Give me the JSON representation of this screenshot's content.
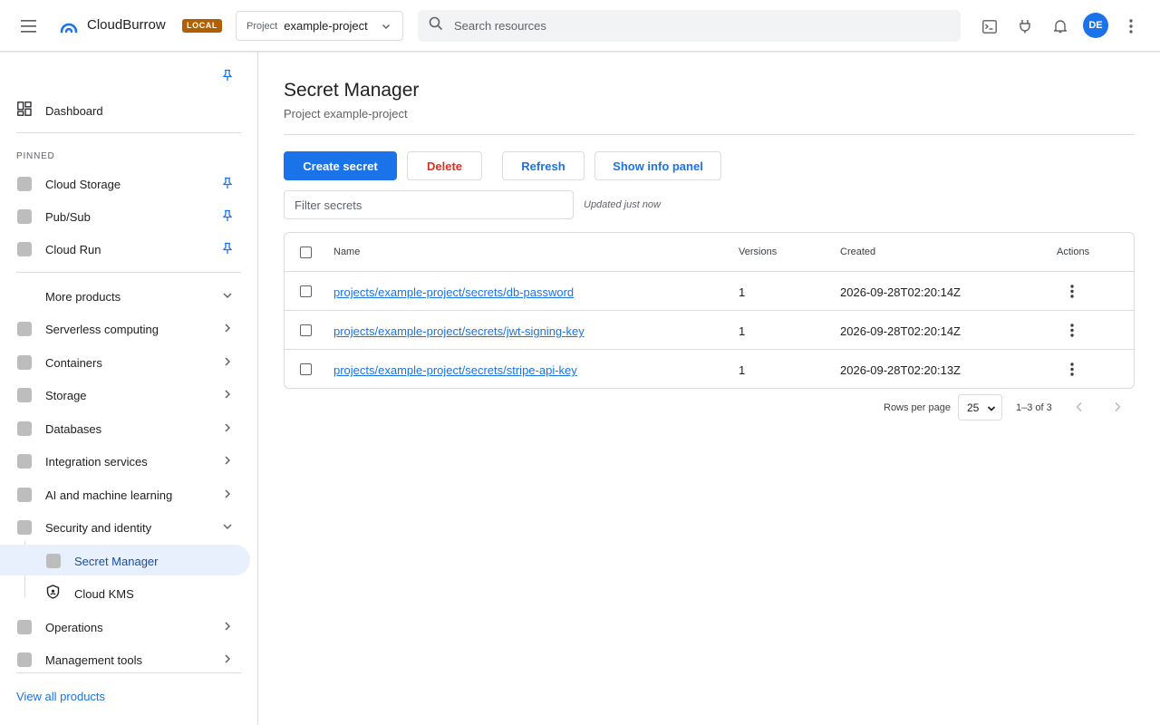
{
  "topbar": {
    "app_title": "CloudBurrow",
    "env_badge": "LOCAL",
    "project_label": "Project",
    "project_value": "example-project",
    "search_placeholder": "Search resources",
    "avatar_initials": "DE",
    "avatar_color": "#1a73e8"
  },
  "sidebar": {
    "dashboard": "Dashboard",
    "pinned_header": "PINNED",
    "pinned": [
      "Cloud Storage",
      "Pub/Sub",
      "Cloud Run"
    ],
    "more_products": "More products",
    "categories": [
      "Serverless computing",
      "Containers",
      "Storage",
      "Databases",
      "Integration services",
      "AI and machine learning",
      "Security and identity"
    ],
    "security_children": [
      "Secret Manager",
      "Cloud KMS"
    ],
    "active_item": "Secret Manager",
    "bottom_categories": [
      "Operations",
      "Management tools"
    ],
    "view_all": "View all products"
  },
  "main": {
    "title": "Secret Manager",
    "subtitle": "Project example-project",
    "buttons": {
      "create": "Create secret",
      "delete": "Delete",
      "refresh": "Refresh",
      "info_panel": "Show info panel"
    },
    "filter_placeholder": "Filter secrets",
    "updated_text": "Updated just now",
    "table": {
      "columns": [
        "Name",
        "Versions",
        "Created",
        "Actions"
      ],
      "rows": [
        {
          "name": "projects/example-project/secrets/db-password",
          "versions": "1",
          "created": "2026-09-28T02:20:14Z"
        },
        {
          "name": "projects/example-project/secrets/jwt-signing-key",
          "versions": "1",
          "created": "2026-09-28T02:20:14Z"
        },
        {
          "name": "projects/example-project/secrets/stripe-api-key",
          "versions": "1",
          "created": "2026-09-28T02:20:13Z"
        }
      ]
    },
    "pagination": {
      "rows_per_page_label": "Rows per page",
      "rows_per_page_value": "25",
      "range_text": "1–3 of 3"
    }
  },
  "colors": {
    "accent": "#1a73e8",
    "danger": "#d93025",
    "badge": "#b06000",
    "active_bg": "#e8f0fe"
  },
  "icons": {
    "menu": "hamburger-menu-icon",
    "logo": "cloud-logo-icon",
    "search": "search-icon",
    "terminal": "terminal-icon",
    "plugin": "plug-icon",
    "notifications": "bell-icon",
    "more": "more-vertical-icon",
    "pin": "pin-icon",
    "dashboard": "dashboard-grid-icon",
    "kms": "shield-icon"
  }
}
